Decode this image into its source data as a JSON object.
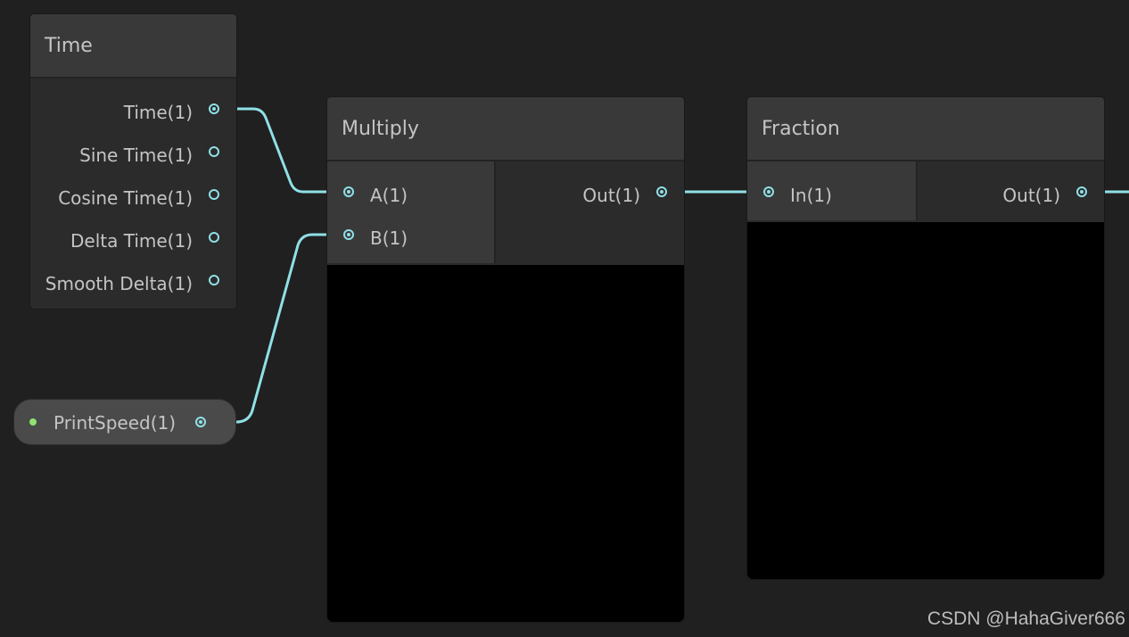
{
  "wire_color": "#8fe0e6",
  "port_color": "#8fe0e6",
  "property_dot_color": "#8fe270",
  "time_node": {
    "title": "Time",
    "outputs": [
      "Time(1)",
      "Sine Time(1)",
      "Cosine Time(1)",
      "Delta Time(1)",
      "Smooth Delta(1)"
    ]
  },
  "property_node": {
    "label": "PrintSpeed(1)"
  },
  "multiply_node": {
    "title": "Multiply",
    "inputs": [
      "A(1)",
      "B(1)"
    ],
    "output": "Out(1)"
  },
  "fraction_node": {
    "title": "Fraction",
    "input": "In(1)",
    "output": "Out(1)"
  },
  "watermark": "CSDN @HahaGiver666"
}
